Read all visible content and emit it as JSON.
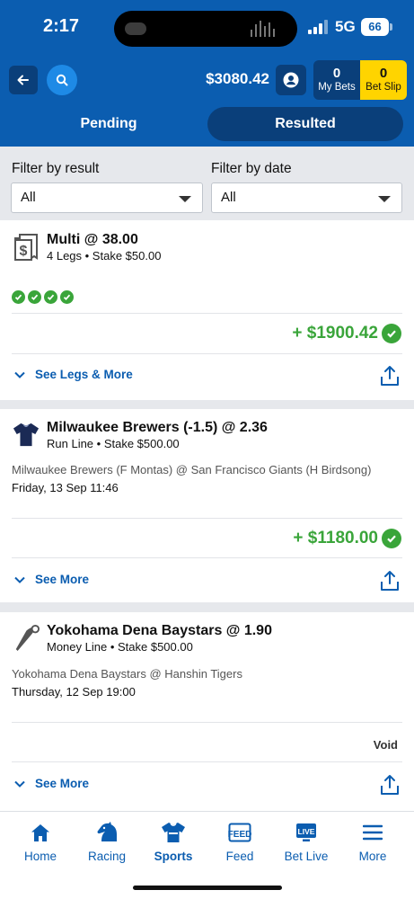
{
  "status_bar": {
    "time": "2:17",
    "network": "5G",
    "battery": "66"
  },
  "header": {
    "balance": "$3080.42",
    "my_bets": {
      "count": "0",
      "label": "My Bets"
    },
    "bet_slip": {
      "count": "0",
      "label": "Bet Slip"
    },
    "tabs": [
      {
        "label": "Pending",
        "active": false
      },
      {
        "label": "Resulted",
        "active": true
      }
    ]
  },
  "filters": {
    "result": {
      "label": "Filter by result",
      "value": "All"
    },
    "date": {
      "label": "Filter by date",
      "value": "All"
    }
  },
  "bets": [
    {
      "icon": "multi-bet-receipt-icon",
      "title": "Multi @ 38.00",
      "subtitle": "4 Legs • Stake $50.00",
      "legs_won": 4,
      "payout": "+ $1900.42",
      "result": "won",
      "toggle_label": "See Legs & More"
    },
    {
      "icon": "team-jersey-icon",
      "title": "Milwaukee Brewers (-1.5) @ 2.36",
      "subtitle": "Run Line • Stake $500.00",
      "event": "Milwaukee Brewers (F Montas) @ San Francisco Giants (H Birdsong)",
      "date": "Friday, 13 Sep 11:46",
      "payout": "+ $1180.00",
      "result": "won",
      "toggle_label": "See More"
    },
    {
      "icon": "baseball-bat-icon",
      "title": "Yokohama Dena Baystars @ 1.90",
      "subtitle": "Money Line • Stake $500.00",
      "event": "Yokohama Dena Baystars @ Hanshin Tigers",
      "date": "Thursday, 12 Sep 19:00",
      "payout": "Void",
      "result": "void",
      "toggle_label": "See More"
    }
  ],
  "bottom_nav": [
    {
      "label": "Home",
      "icon": "home-icon",
      "active": false
    },
    {
      "label": "Racing",
      "icon": "horse-head-icon",
      "active": false
    },
    {
      "label": "Sports",
      "icon": "jersey-icon",
      "active": true
    },
    {
      "label": "Feed",
      "icon": "feed-icon",
      "active": false
    },
    {
      "label": "Bet Live",
      "icon": "live-tv-icon",
      "active": false
    },
    {
      "label": "More",
      "icon": "hamburger-menu-icon",
      "active": false
    }
  ],
  "colors": {
    "brand_blue": "#0b5db0",
    "dark_blue": "#0a3f7a",
    "win_green": "#3aa53a",
    "bet_slip_yellow": "#ffd400"
  }
}
